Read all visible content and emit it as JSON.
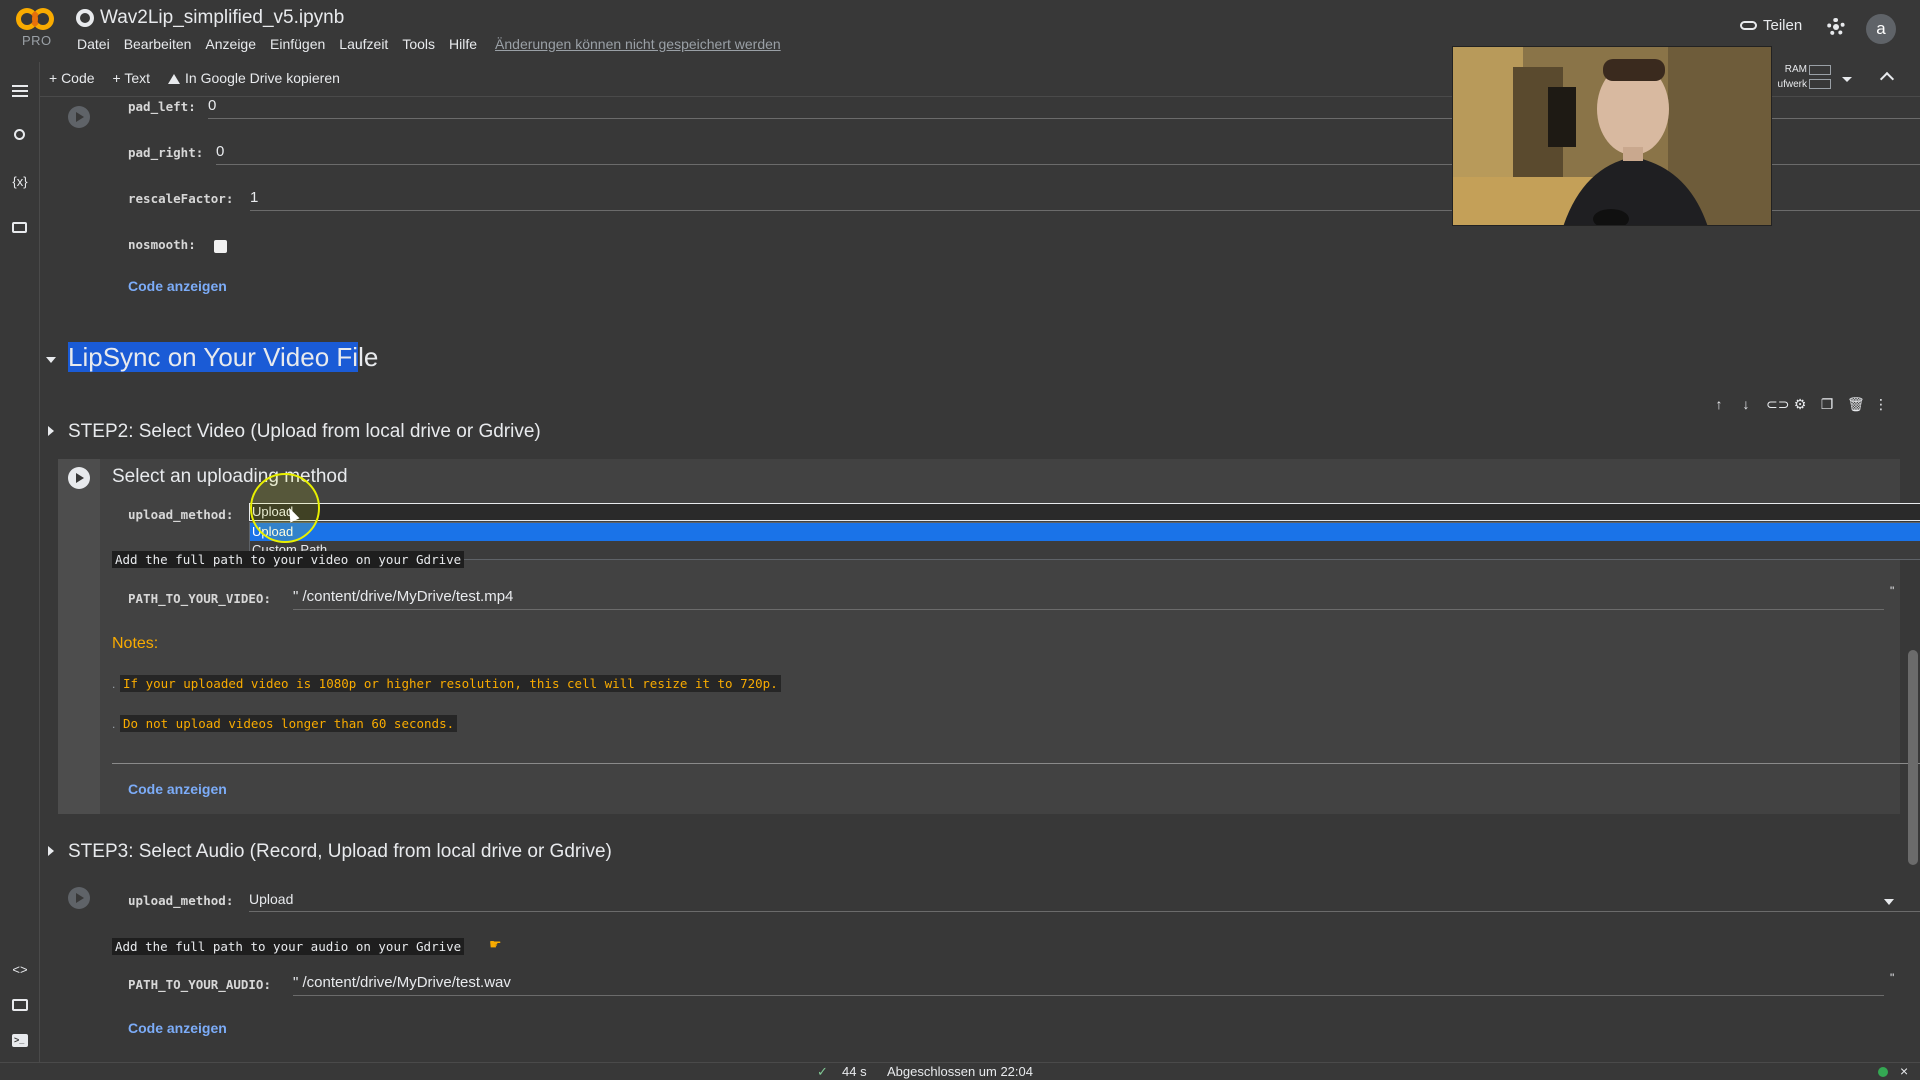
{
  "header": {
    "logo_badge": "PRO",
    "notebook_title": "Wav2Lip_simplified_v5.ipynb",
    "menu": [
      "Datei",
      "Bearbeiten",
      "Anzeige",
      "Einfügen",
      "Laufzeit",
      "Tools",
      "Hilfe"
    ],
    "unsaved_notice": "Änderungen können nicht gespeichert werden",
    "share_label": "Teilen",
    "avatar_initial": "a"
  },
  "toolbar": {
    "add_code": "+ Code",
    "add_text": "+ Text",
    "copy_drive": "In Google Drive kopieren",
    "ram_label": "RAM",
    "disk_label": "ufwerk"
  },
  "cell1": {
    "fields": [
      {
        "label": "pad_left:",
        "value": "0"
      },
      {
        "label": "pad_right:",
        "value": "0"
      },
      {
        "label": "rescaleFactor:",
        "value": "1"
      }
    ],
    "nosmooth_label": "nosmooth:",
    "show_code": "Code anzeigen"
  },
  "section": {
    "title_selected": "LipSync on Your Video Fi",
    "title_rest": "le"
  },
  "step2": {
    "title": "STEP2: Select Video (Upload from local drive or Gdrive)",
    "form_title": "Select an uploading method",
    "upload_method_label": "upload_method:",
    "upload_method_value": "Upload",
    "dropdown_options": [
      "Upload",
      "Custom Path"
    ],
    "gdrive_hint": "Add the full path to your video on your Gdrive",
    "path_label": "PATH_TO_YOUR_VIDEO:",
    "path_value": "\" /content/drive/MyDrive/test.mp4",
    "path_end_quote": "\"",
    "notes_title": "Notes:",
    "notes": [
      "If your uploaded video is 1080p or higher resolution, this cell will resize it to 720p.",
      "Do not upload videos longer than 60 seconds."
    ],
    "show_code": "Code anzeigen"
  },
  "step3": {
    "title": "STEP3: Select Audio (Record, Upload from local drive or Gdrive)",
    "upload_method_label": "upload_method:",
    "upload_method_value": "Upload",
    "gdrive_hint": "Add the full path to your audio on your Gdrive",
    "path_label": "PATH_TO_YOUR_AUDIO:",
    "path_value": "\" /content/drive/MyDrive/test.wav",
    "path_end_quote": "\"",
    "show_code": "Code anzeigen"
  },
  "status": {
    "check": "✓",
    "elapsed": "44 s",
    "completed": "Abgeschlossen um 22:04",
    "close": "×"
  },
  "colors": {
    "background": "#383838",
    "accent_blue": "#1a73e8",
    "link_blue": "#7cacf8",
    "warning_orange": "#f9ab00",
    "logo_orange": "#f9ab00"
  },
  "icons": [
    "github-icon",
    "link-icon",
    "gear-icon",
    "drive-icon",
    "toc-icon",
    "search-icon",
    "variables-icon",
    "folder-icon",
    "code-snippets-icon",
    "command-palette-icon",
    "terminal-icon",
    "arrow-up-icon",
    "arrow-down-icon",
    "cell-link-icon",
    "cell-settings-icon",
    "mirror-cell-icon",
    "trash-icon",
    "more-vert-icon"
  ]
}
